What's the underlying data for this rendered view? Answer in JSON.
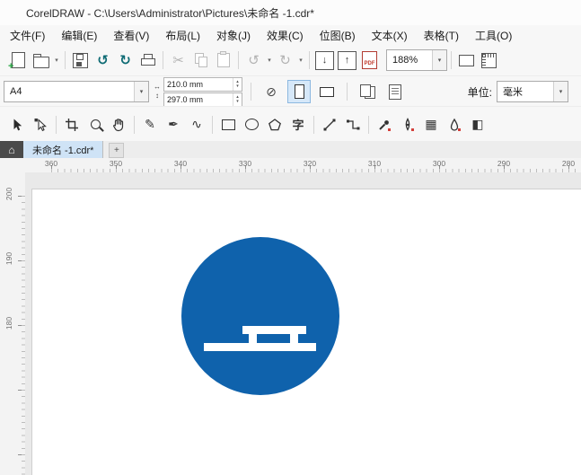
{
  "colors": {
    "sign_blue": "#0f62ac",
    "logo_green": "#35b34a",
    "tab_highlight": "#cfe3f6"
  },
  "titlebar": {
    "title": "CorelDRAW - C:\\Users\\Administrator\\Pictures\\未命名 -1.cdr*"
  },
  "menu": {
    "items": [
      {
        "label": "文件(F)"
      },
      {
        "label": "编辑(E)"
      },
      {
        "label": "查看(V)"
      },
      {
        "label": "布局(L)"
      },
      {
        "label": "对象(J)"
      },
      {
        "label": "效果(C)"
      },
      {
        "label": "位图(B)"
      },
      {
        "label": "文本(X)"
      },
      {
        "label": "表格(T)"
      },
      {
        "label": "工具(O)"
      }
    ]
  },
  "toolbar": {
    "zoom_value": "188%",
    "pdf_label": "PDF"
  },
  "property_bar": {
    "page_size_value": "A4",
    "width_value": "210.0 mm",
    "height_value": "297.0 mm",
    "units_label": "单位:",
    "units_value": "毫米"
  },
  "toolbox": {
    "text_tool_label": "字"
  },
  "tabs": {
    "active_tab": "未命名 -1.cdr*",
    "add_label": "+"
  },
  "rulers": {
    "horizontal": [
      "360",
      "350",
      "340",
      "330",
      "320",
      "310",
      "300",
      "290",
      "280"
    ],
    "vertical": [
      "200",
      "190",
      "180"
    ]
  },
  "icons": {
    "chevron_down": "▾",
    "new_plus": "+",
    "cloud_save": "↺",
    "cloud_open": "↻",
    "cut": "✂",
    "undo": "↺",
    "redo": "↻",
    "import_arrow": "↓",
    "export_arrow": "↑",
    "home": "⌂",
    "width_arrow": "↔",
    "height_arrow": "↕",
    "spin_up": "▴",
    "spin_down": "▾",
    "fit_page": "⊘",
    "freehand": "✎",
    "bezier": "✒",
    "artistic": "∿",
    "mesh_fill": "▦",
    "interactive_fill": "◧"
  }
}
